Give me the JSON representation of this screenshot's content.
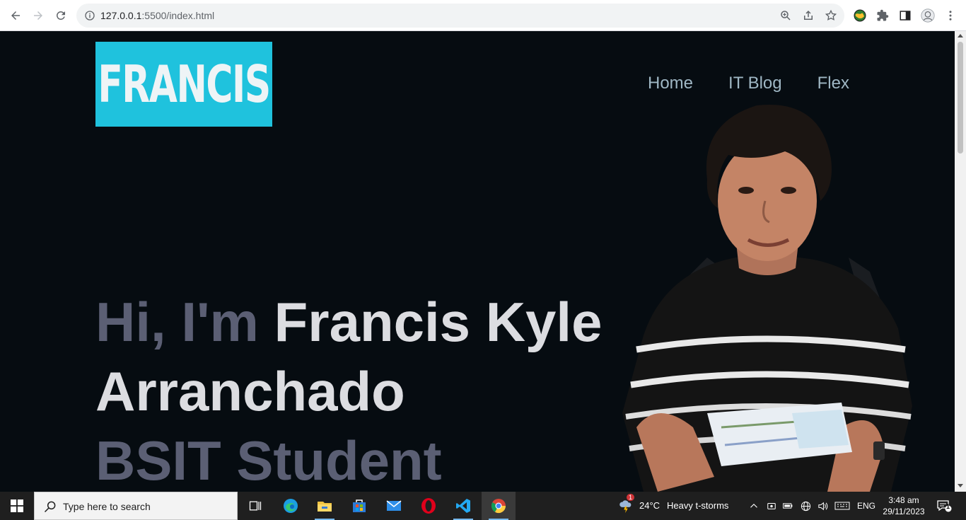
{
  "browser": {
    "url_host": "127.0.0.1",
    "url_rest": ":5500/index.html"
  },
  "site": {
    "logo_text": "FRANCIS",
    "nav": [
      "Home",
      "IT Blog",
      "Flex"
    ],
    "hero": {
      "greeting": "Hi, I'm ",
      "name_part1": "Francis Kyle",
      "name_part2": "Arranchado",
      "role": "BSIT Student"
    }
  },
  "taskbar": {
    "search_placeholder": "Type here to search",
    "weather_temp": "24°C",
    "weather_desc": "Heavy t-storms",
    "weather_badge": "1",
    "language": "ENG",
    "time": "3:48 am",
    "date": "29/11/2023",
    "notification_count": "1"
  },
  "colors": {
    "page_bg": "#060c11",
    "logo_bg": "#1fc2dd",
    "nav_link": "#9fb7c4",
    "hero_dim": "#5b5f74",
    "hero_bright": "#dcdde1"
  }
}
